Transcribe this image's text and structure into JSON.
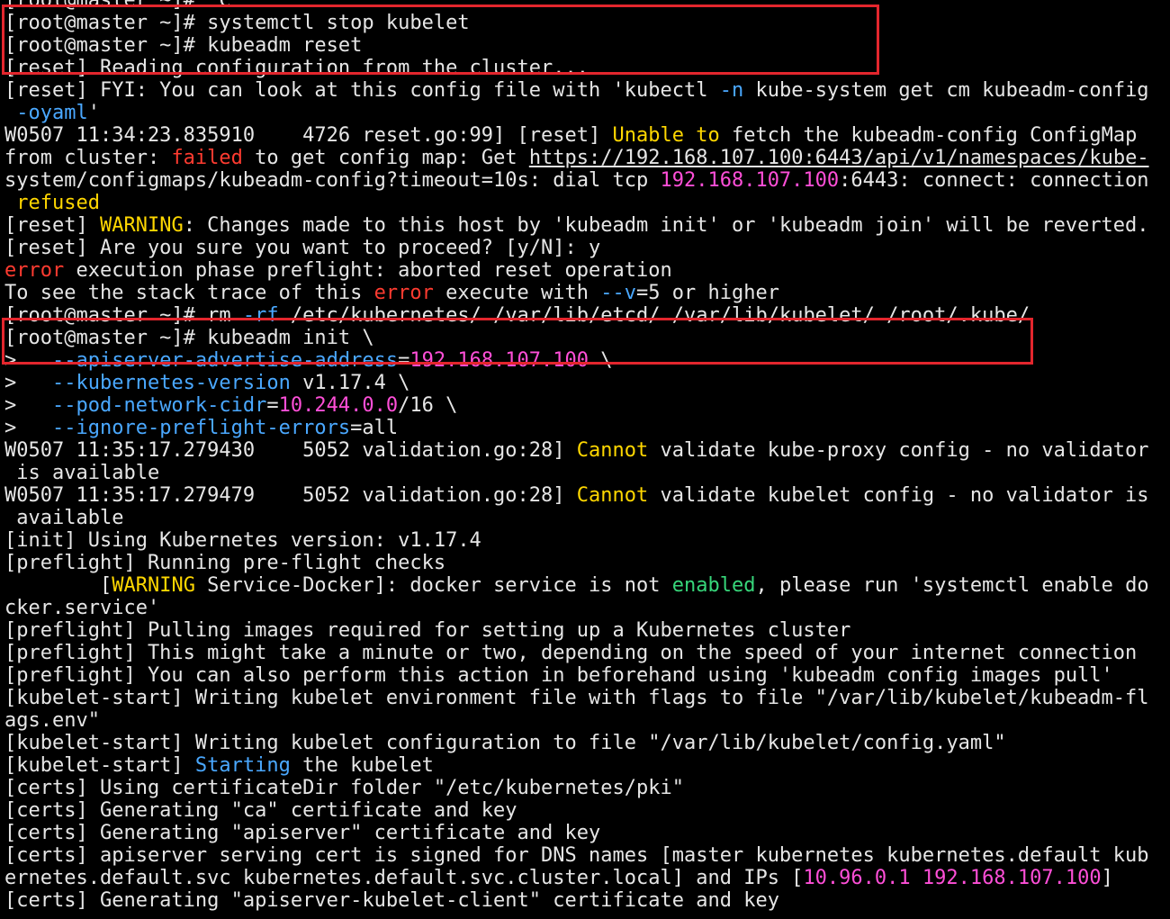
{
  "colors": {
    "background": "#000000",
    "text": "#e6e6e6",
    "yellow": "#ffd700",
    "red": "#ff3b30",
    "blue": "#4aa8ff",
    "magenta": "#ff4fd8",
    "green": "#37d67a",
    "highlight_box": "#e3262d"
  },
  "terminal": {
    "lines": [
      [
        {
          "t": "[root@master ~]# ^C"
        }
      ],
      [
        {
          "t": "[root@master ~]# systemctl stop kubelet"
        }
      ],
      [
        {
          "t": "[root@master ~]# kubeadm reset"
        }
      ],
      [
        {
          "t": "[reset] Reading configuration from the cluster..."
        }
      ],
      [
        {
          "t": "[reset] FYI: You can look at this config file with 'kubectl "
        },
        {
          "t": "-n",
          "c": "blue"
        },
        {
          "t": " kube-system get cm kubeadm-config"
        }
      ],
      [
        {
          "t": " "
        },
        {
          "t": "-oyaml",
          "c": "blue"
        },
        {
          "t": "'"
        }
      ],
      [
        {
          "t": "W0507 11:34:23.835910    4726 reset.go:99] [reset] "
        },
        {
          "t": "Unable to",
          "c": "yellow"
        },
        {
          "t": " fetch the kubeadm-config ConfigMap"
        }
      ],
      [
        {
          "t": "from cluster: "
        },
        {
          "t": "failed",
          "c": "red"
        },
        {
          "t": " to get config map: Get "
        },
        {
          "t": "https://192.168.107.100:6443/api/v1/namespaces/kube-",
          "c": "underline"
        }
      ],
      [
        {
          "t": "system/configmaps/kubeadm-config?timeout=10s: dial tcp "
        },
        {
          "t": "192.168.107.100",
          "c": "magenta"
        },
        {
          "t": ":6443: connect: connection"
        }
      ],
      [
        {
          "t": " "
        },
        {
          "t": "refused",
          "c": "yellow"
        }
      ],
      [
        {
          "t": "[reset] "
        },
        {
          "t": "WARNING",
          "c": "yellow"
        },
        {
          "t": ": Changes made to this host by 'kubeadm init' or 'kubeadm join' will be reverted."
        }
      ],
      [
        {
          "t": "[reset] Are you sure you want to proceed? [y/N]: y"
        }
      ],
      [
        {
          "t": "error",
          "c": "red"
        },
        {
          "t": " execution phase preflight: aborted reset operation"
        }
      ],
      [
        {
          "t": "To see the stack trace of this "
        },
        {
          "t": "error",
          "c": "red"
        },
        {
          "t": " execute with "
        },
        {
          "t": "--v",
          "c": "blue"
        },
        {
          "t": "=5 or higher"
        }
      ],
      [
        {
          "t": "[root@master ~]# rm "
        },
        {
          "t": "-rf",
          "c": "blue"
        },
        {
          "t": " /etc/kubernetes/ /var/lib/etcd/ /var/lib/kubelet/ /root/.kube/"
        }
      ],
      [
        {
          "t": "[root@master ~]# kubeadm init \\"
        }
      ],
      [
        {
          "t": ">   "
        },
        {
          "t": "--apiserver-advertise-address",
          "c": "blue"
        },
        {
          "t": "="
        },
        {
          "t": "192.168.107.100",
          "c": "magenta"
        },
        {
          "t": " \\"
        }
      ],
      [
        {
          "t": ">   "
        },
        {
          "t": "--kubernetes-version",
          "c": "blue"
        },
        {
          "t": " v1.17.4 \\"
        }
      ],
      [
        {
          "t": ">   "
        },
        {
          "t": "--pod-network-cidr",
          "c": "blue"
        },
        {
          "t": "="
        },
        {
          "t": "10.244.0.0",
          "c": "magenta"
        },
        {
          "t": "/16 \\"
        }
      ],
      [
        {
          "t": ">   "
        },
        {
          "t": "--ignore-preflight-errors",
          "c": "blue"
        },
        {
          "t": "=all"
        }
      ],
      [
        {
          "t": "W0507 11:35:17.279430    5052 validation.go:28] "
        },
        {
          "t": "Cannot",
          "c": "yellow"
        },
        {
          "t": " validate kube-proxy config - no validator"
        }
      ],
      [
        {
          "t": " is available"
        }
      ],
      [
        {
          "t": "W0507 11:35:17.279479    5052 validation.go:28] "
        },
        {
          "t": "Cannot",
          "c": "yellow"
        },
        {
          "t": " validate kubelet config - no validator is"
        }
      ],
      [
        {
          "t": " available"
        }
      ],
      [
        {
          "t": "[init] Using Kubernetes version: v1.17.4"
        }
      ],
      [
        {
          "t": "[preflight] Running pre-flight checks"
        }
      ],
      [
        {
          "t": "        ["
        },
        {
          "t": "WARNING",
          "c": "yellow"
        },
        {
          "t": " Service-Docker]: docker service is not "
        },
        {
          "t": "enabled",
          "c": "green"
        },
        {
          "t": ", please run 'systemctl enable do"
        }
      ],
      [
        {
          "t": "cker.service'"
        }
      ],
      [
        {
          "t": "[preflight] Pulling images required for setting up a Kubernetes cluster"
        }
      ],
      [
        {
          "t": "[preflight] This might take a minute or two, depending on the speed of your internet connection"
        }
      ],
      [
        {
          "t": "[preflight] You can also perform this action in beforehand using 'kubeadm config images pull'"
        }
      ],
      [
        {
          "t": "[kubelet-start] Writing kubelet environment file with flags to file \"/var/lib/kubelet/kubeadm-fl"
        }
      ],
      [
        {
          "t": "ags.env\""
        }
      ],
      [
        {
          "t": "[kubelet-start] Writing kubelet configuration to file \"/var/lib/kubelet/config.yaml\""
        }
      ],
      [
        {
          "t": "[kubelet-start] "
        },
        {
          "t": "Starting",
          "c": "blue"
        },
        {
          "t": " the kubelet"
        }
      ],
      [
        {
          "t": "[certs] Using certificateDir folder \"/etc/kubernetes/pki\""
        }
      ],
      [
        {
          "t": "[certs] Generating \"ca\" certificate and key"
        }
      ],
      [
        {
          "t": "[certs] Generating \"apiserver\" certificate and key"
        }
      ],
      [
        {
          "t": "[certs] apiserver serving cert is signed for DNS names [master kubernetes kubernetes.default kub"
        }
      ],
      [
        {
          "t": "ernetes.default.svc kubernetes.default.svc.cluster.local] and IPs ["
        },
        {
          "t": "10.96.0.1",
          "c": "magenta"
        },
        {
          "t": " "
        },
        {
          "t": "192.168.107.100",
          "c": "magenta"
        },
        {
          "t": "]"
        }
      ],
      [
        {
          "t": "[certs] Generating \"apiserver-kubelet-client\" certificate and key"
        }
      ]
    ]
  }
}
